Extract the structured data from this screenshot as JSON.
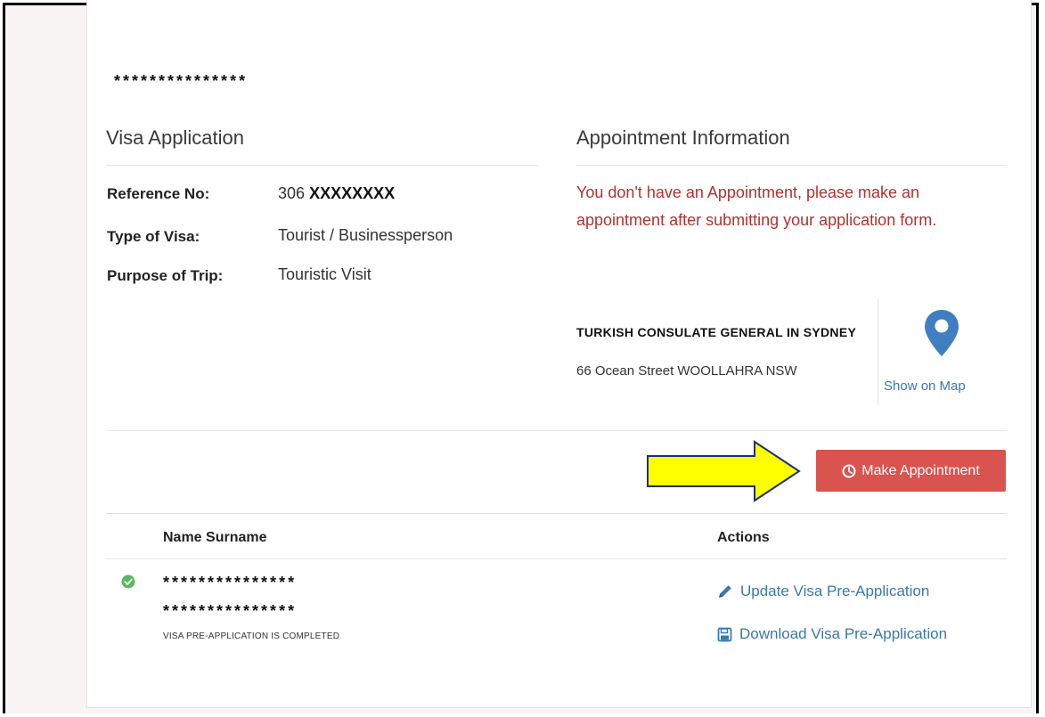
{
  "header": {
    "masked_name": "***************"
  },
  "visa_application": {
    "title": "Visa Application",
    "fields": [
      {
        "label": "Reference No:",
        "value_prefix": "306",
        "value_masked": "XXXXXXXX"
      },
      {
        "label": "Type of Visa:",
        "value": "Tourist / Businessperson"
      },
      {
        "label": "Purpose of Trip:",
        "value": "Touristic Visit"
      }
    ]
  },
  "appointment": {
    "title": "Appointment Information",
    "warning": "You don't have an Appointment, please make an appointment after submitting your application form.",
    "consulate_name": "TURKISH CONSULATE GENERAL IN SYDNEY",
    "consulate_address": "66 Ocean Street WOOLLAHRA NSW",
    "map_link": "Show on Map",
    "make_appointment_label": "Make Appointment"
  },
  "table": {
    "headers": {
      "name": "Name Surname",
      "actions": "Actions"
    },
    "rows": [
      {
        "name_line1": "***************",
        "name_line2": "***************",
        "status": "VISA PRE-APPLICATION IS COMPLETED",
        "update_label": "Update Visa Pre-Application",
        "download_label": "Download Visa Pre-Application"
      }
    ]
  },
  "icons": {
    "pin": "map-pin-icon",
    "clock": "clock-icon",
    "check": "check-circle-icon",
    "pencil": "pencil-icon",
    "save": "floppy-disk-icon",
    "arrow": "yellow-arrow-icon"
  },
  "colors": {
    "accent_red": "#d9534f",
    "warning_text": "#b0332f",
    "link_blue": "#3a78b0",
    "pin_blue": "#3f7fc1",
    "success_green": "#5cb85c",
    "arrow_yellow": "#ffff00"
  }
}
